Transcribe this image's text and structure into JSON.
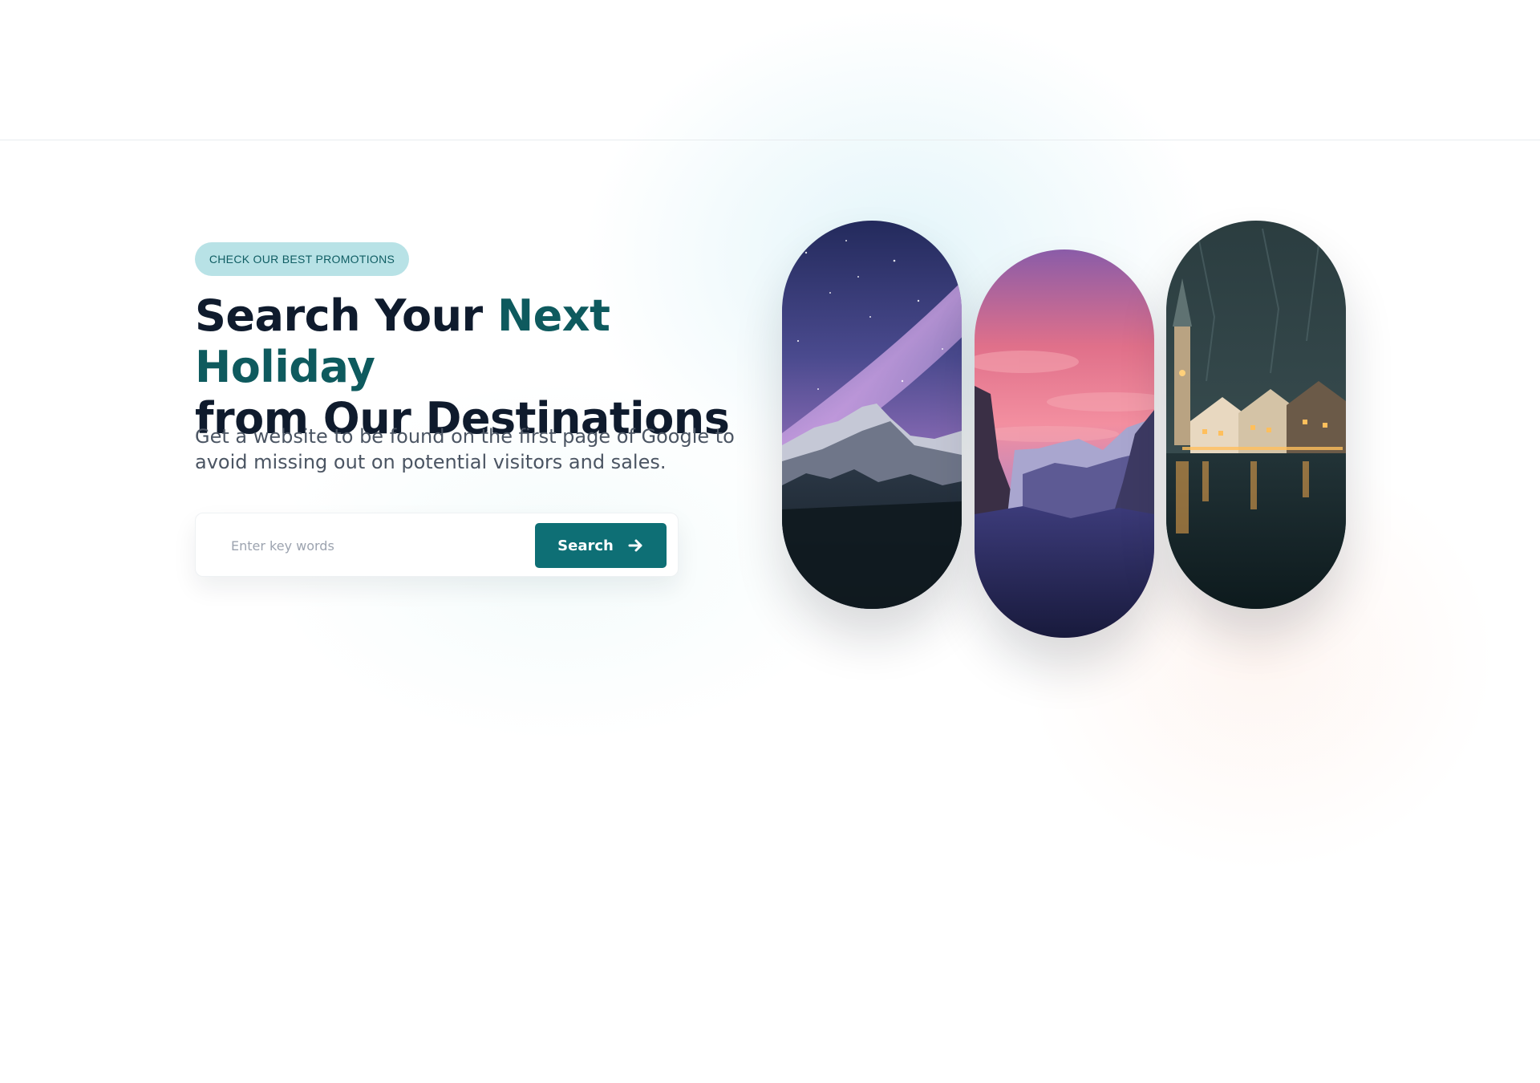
{
  "promo": {
    "label": "CHECK OUR BEST PROMOTIONS"
  },
  "hero": {
    "title_part1": "Search Your ",
    "title_accent": "Next Holiday",
    "title_part2": "from Our Destinations",
    "subtitle": "Get a website to be found on the first page of Google to avoid missing out on potential visitors and sales."
  },
  "search": {
    "placeholder": "Enter key words",
    "value": "",
    "button_label": "Search",
    "button_icon": "arrow-right-icon"
  },
  "destinations": [
    {
      "image": "milky-way-mountain-photo"
    },
    {
      "image": "sunset-valley-photo"
    },
    {
      "image": "lakeside-village-night-photo"
    }
  ],
  "colors": {
    "accent": "#0e5a5e",
    "button": "#0e6f75",
    "badge_bg": "#b8e2e6",
    "badge_text": "#0f5d63",
    "heading": "#0f1b2d"
  }
}
